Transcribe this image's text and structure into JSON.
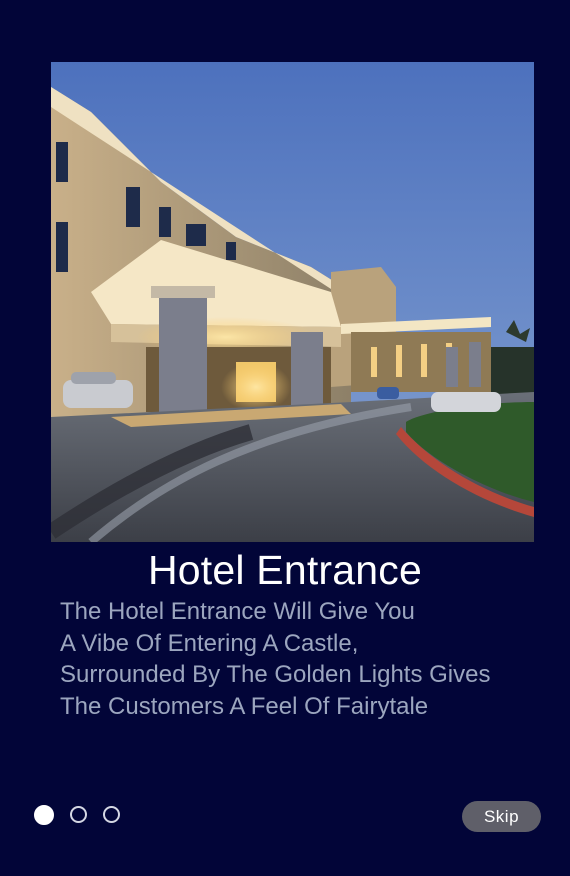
{
  "slide": {
    "title": "Hotel Entrance",
    "description_lines": [
      "The Hotel Entrance Will Give You",
      "A Vibe Of Entering A Castle,",
      "Surrounded By The Golden Lights Gives",
      "The Customers A Feel Of Fairytale"
    ],
    "image_icon": "hotel-entrance-photo"
  },
  "pager": {
    "total": 3,
    "active_index": 0
  },
  "actions": {
    "skip_label": "Skip"
  },
  "colors": {
    "background": "#020538",
    "title": "#ffffff",
    "description": "#9ca6bf",
    "skip_button": "#5f5f69"
  }
}
